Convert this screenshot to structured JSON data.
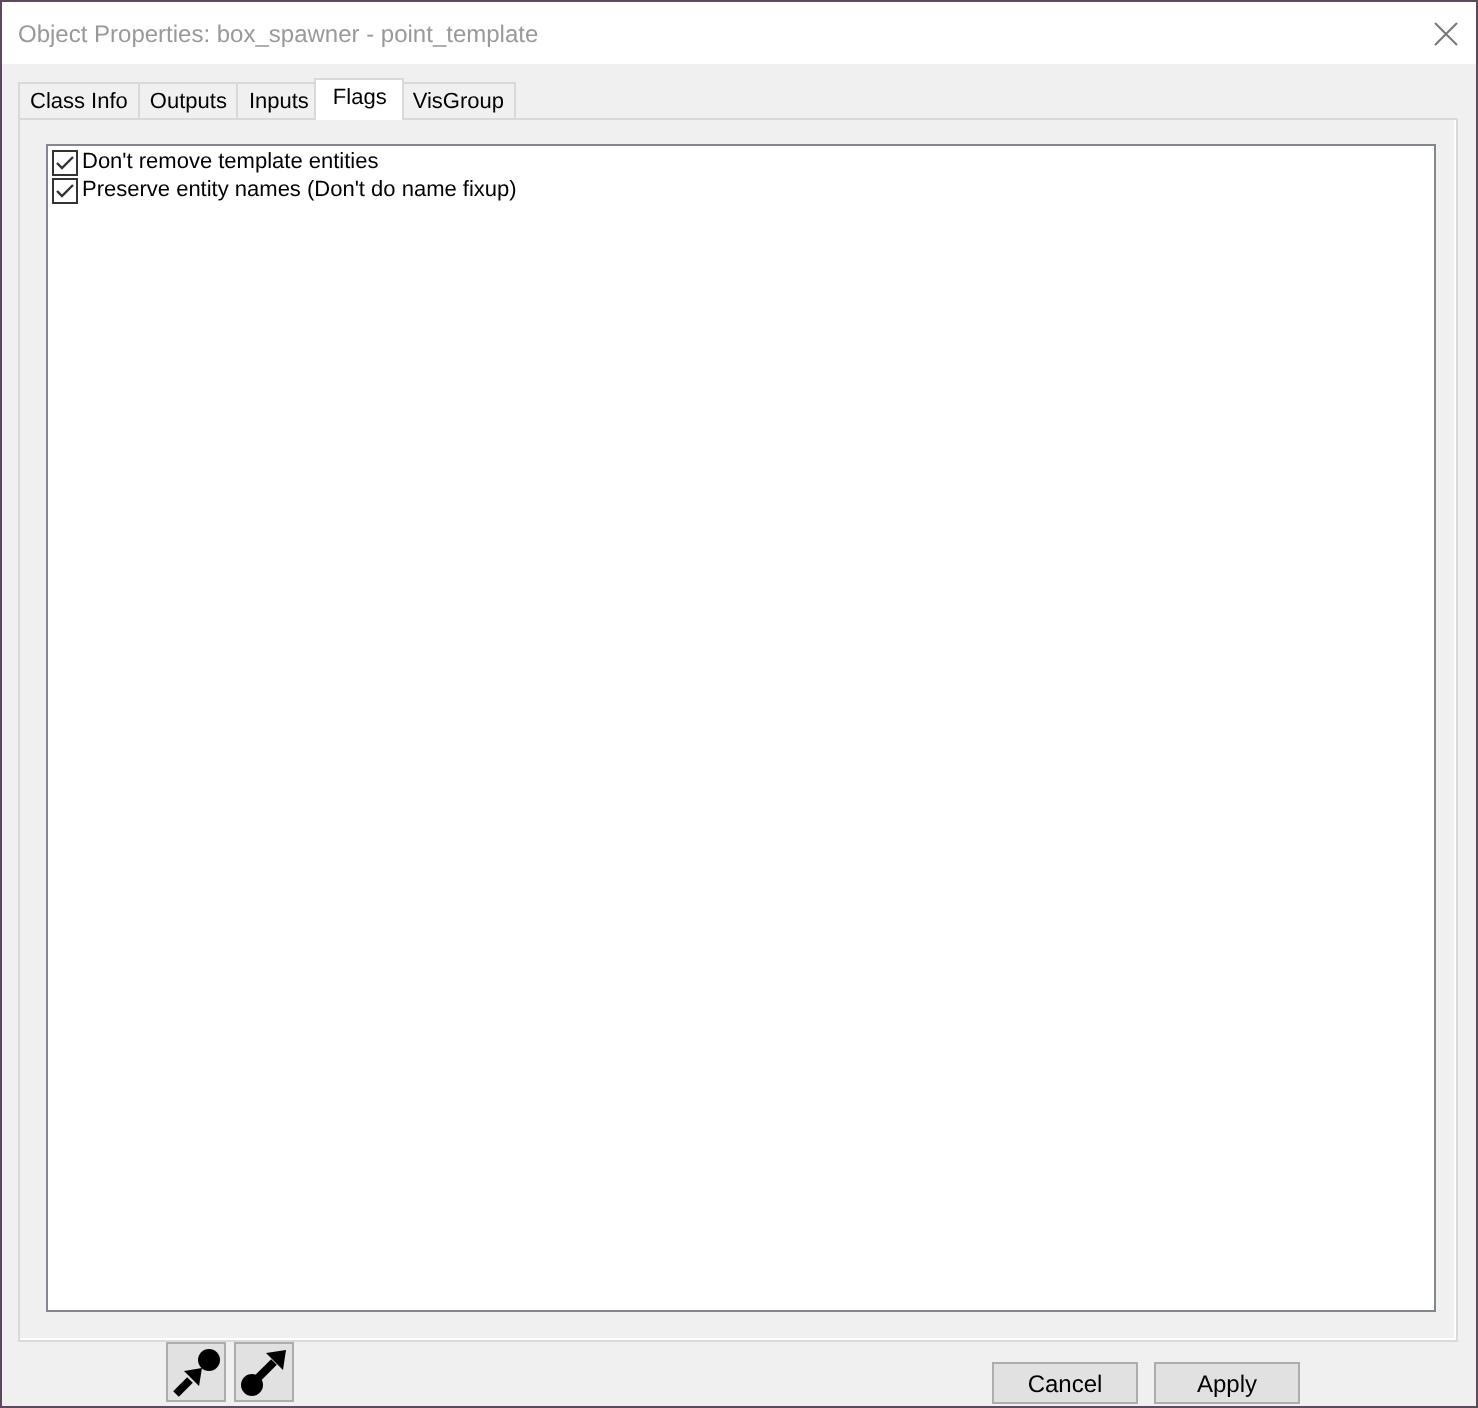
{
  "window": {
    "title": "Object Properties: box_spawner - point_template"
  },
  "tabs": [
    {
      "label": "Class Info",
      "selected": false
    },
    {
      "label": "Outputs",
      "selected": false
    },
    {
      "label": "Inputs",
      "selected": false
    },
    {
      "label": "Flags",
      "selected": true
    },
    {
      "label": "VisGroup",
      "selected": false
    }
  ],
  "flags": [
    {
      "label": "Don't remove template entities",
      "checked": true
    },
    {
      "label": "Preserve entity names (Don't do name fixup)",
      "checked": true
    }
  ],
  "buttons": [
    "Cancel",
    "Apply"
  ]
}
